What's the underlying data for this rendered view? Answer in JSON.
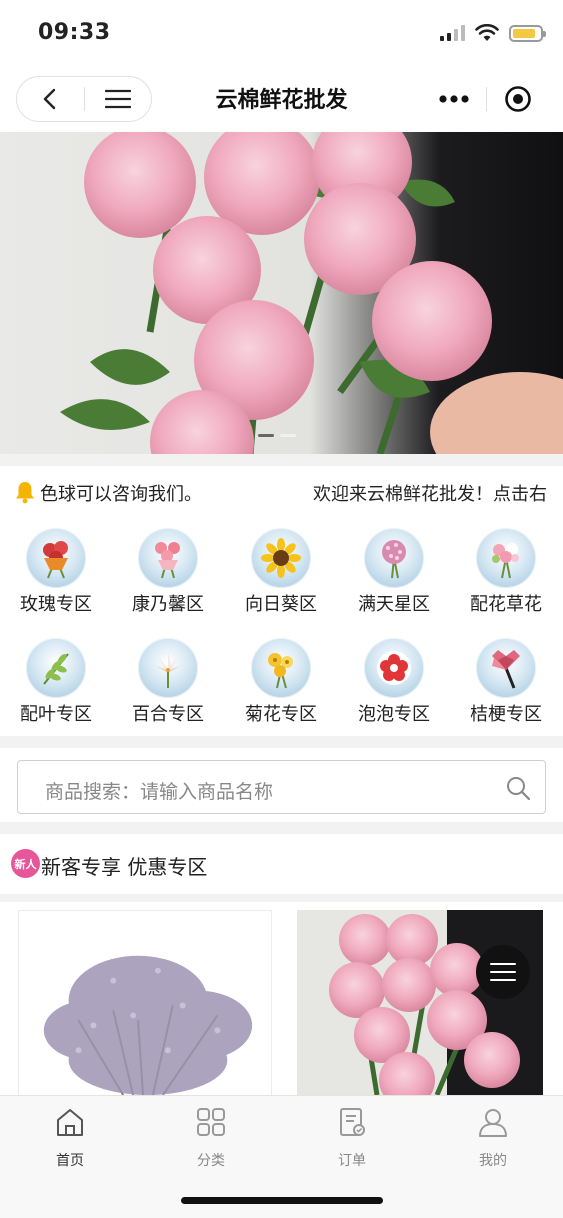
{
  "status_bar": {
    "time": "09:33",
    "battery_level": 0.85
  },
  "nav": {
    "title": "云棉鲜花批发"
  },
  "notice": {
    "text": "色球可以咨询我们。",
    "text_2": "欢迎来云棉鲜花批发！点击右"
  },
  "categories": [
    {
      "label": "玫瑰专区",
      "icon": "rose-bouquet-icon"
    },
    {
      "label": "康乃馨区",
      "icon": "carnation-bouquet-icon"
    },
    {
      "label": "向日葵区",
      "icon": "sunflower-icon"
    },
    {
      "label": "满天星区",
      "icon": "babys-breath-icon"
    },
    {
      "label": "配花草花",
      "icon": "mixed-flowers-icon"
    },
    {
      "label": "配叶专区",
      "icon": "foliage-icon"
    },
    {
      "label": "百合专区",
      "icon": "lily-icon"
    },
    {
      "label": "菊花专区",
      "icon": "chrysanthemum-icon"
    },
    {
      "label": "泡泡专区",
      "icon": "bubble-flower-icon"
    },
    {
      "label": "桔梗专区",
      "icon": "bellflower-icon"
    }
  ],
  "search": {
    "placeholder": "商品搜索：请输入商品名称"
  },
  "section": {
    "badge": "新人",
    "title": "新客专享 优惠专区"
  },
  "tabs": [
    {
      "label": "首页",
      "icon": "home-icon",
      "active": true
    },
    {
      "label": "分类",
      "icon": "grid-icon",
      "active": false
    },
    {
      "label": "订单",
      "icon": "order-icon",
      "active": false
    },
    {
      "label": "我的",
      "icon": "user-icon",
      "active": false
    }
  ],
  "colors": {
    "badge_pink": "#e8569a",
    "pink_flower": "#f0a9bf",
    "battery_yellow": "#f5c842"
  }
}
